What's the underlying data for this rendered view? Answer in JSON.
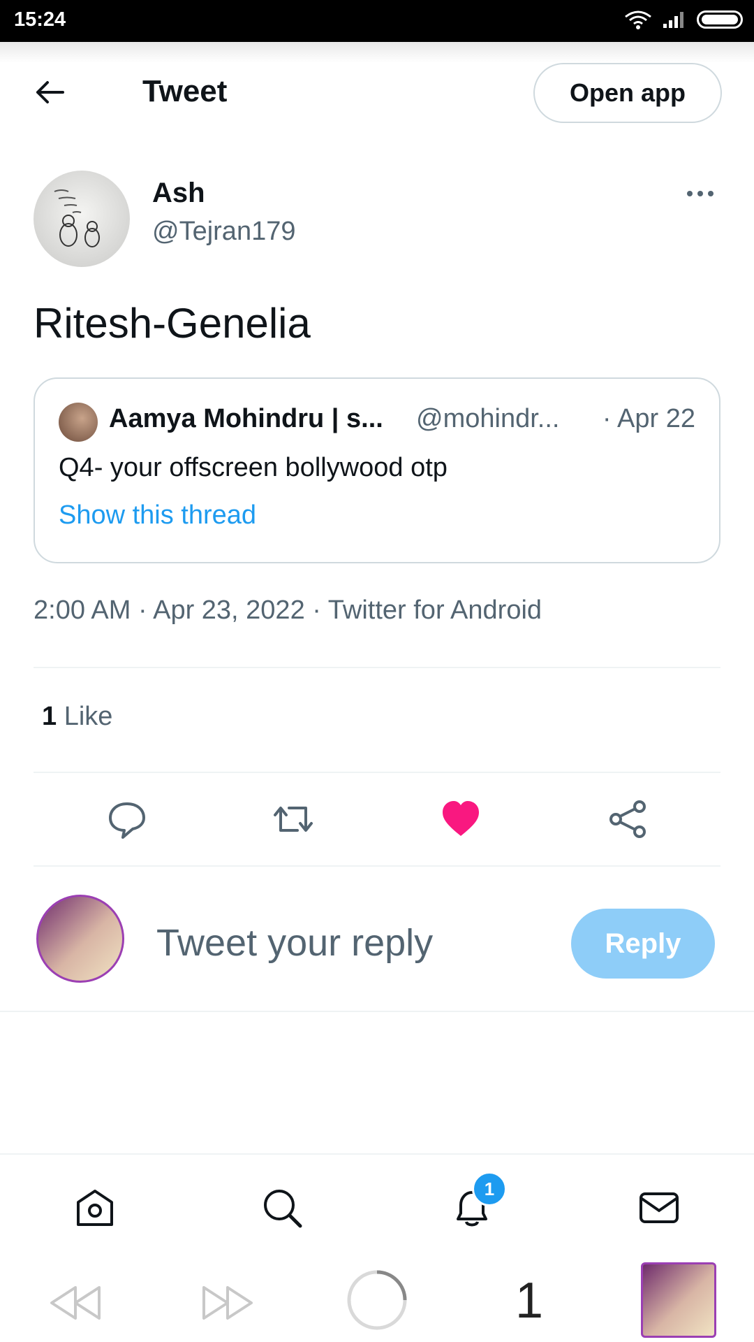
{
  "status_bar": {
    "time": "15:24"
  },
  "header": {
    "title": "Tweet",
    "open_app_label": "Open app"
  },
  "tweet": {
    "author_name": "Ash",
    "author_handle": "@Tejran179",
    "text": "Ritesh-Genelia",
    "quoted": {
      "name": "Aamya Mohindru | s...",
      "handle": "@mohindr...",
      "date": "· Apr 22",
      "text": "Q4- your offscreen bollywood otp",
      "thread_link": "Show this thread"
    },
    "meta": "2:00 AM · Apr 23, 2022 · Twitter for Android",
    "like_count": "1",
    "like_label": "Like"
  },
  "reply": {
    "placeholder": "Tweet your reply",
    "button_label": "Reply"
  },
  "bottom_nav": {
    "notification_badge": "1"
  },
  "browser": {
    "tab_count": "1"
  },
  "colors": {
    "accent": "#1d9bf0",
    "like": "#f91880",
    "reply_button": "#8ecdf8"
  },
  "icons": [
    "back-arrow-icon",
    "more-icon",
    "comment-icon",
    "retweet-icon",
    "heart-icon",
    "share-icon",
    "home-icon",
    "search-icon",
    "bell-icon",
    "mail-icon",
    "rewind-icon",
    "fast-forward-icon",
    "loading-icon"
  ]
}
